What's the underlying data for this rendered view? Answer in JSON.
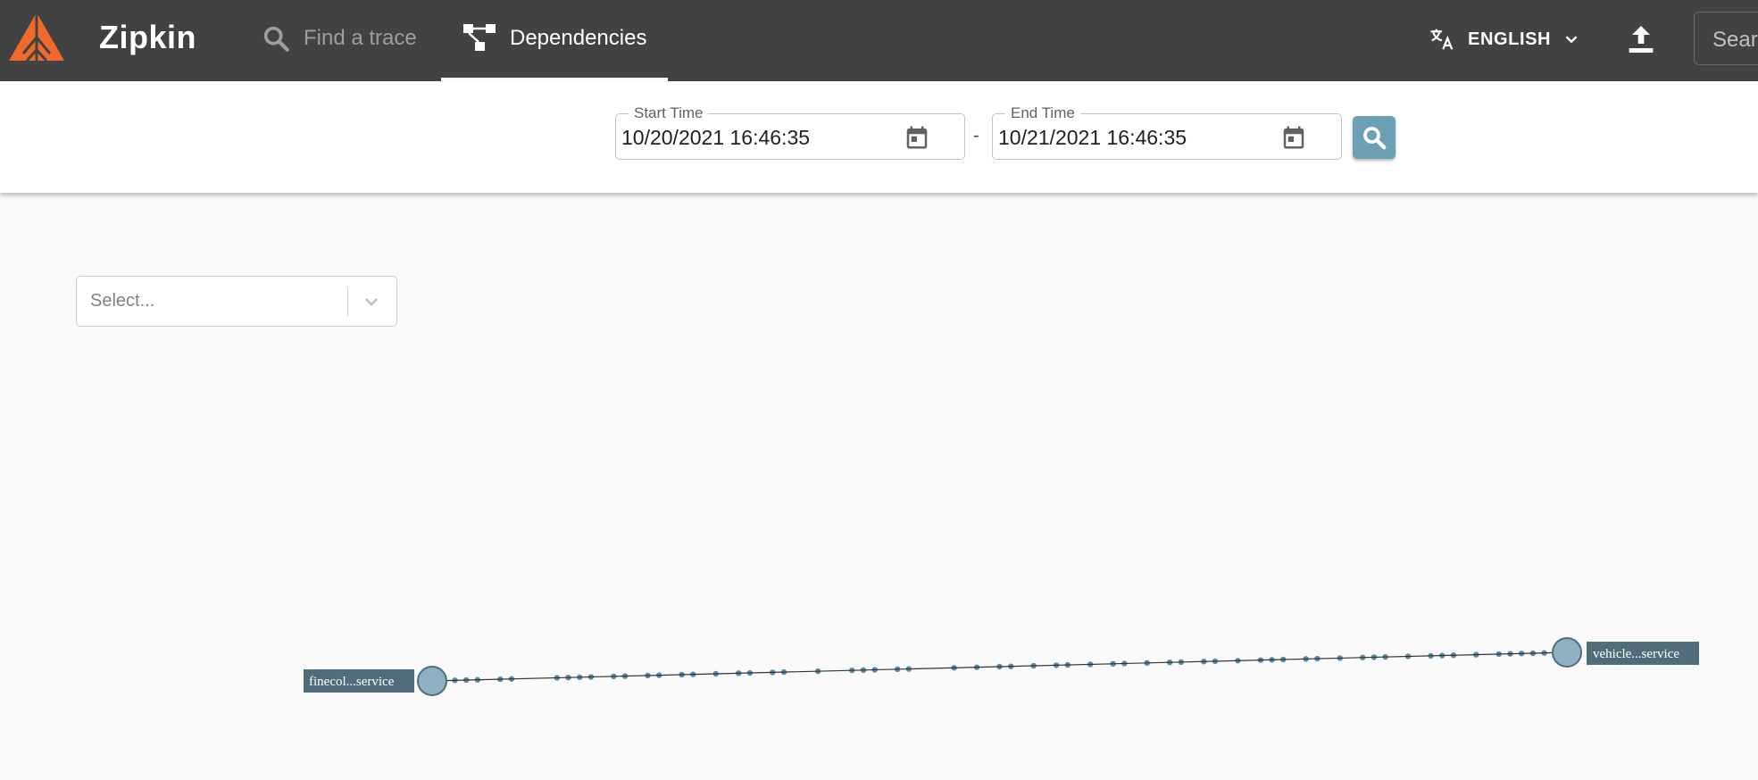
{
  "header": {
    "brand": "Zipkin",
    "nav": {
      "find_trace": "Find a trace",
      "dependencies": "Dependencies"
    },
    "language": "ENGLISH",
    "search_placeholder": "Search"
  },
  "time_range": {
    "start_label": "Start Time",
    "start_value": "10/20/2021 16:46:35",
    "separator": "-",
    "end_label": "End Time",
    "end_value": "10/21/2021 16:46:35"
  },
  "service_select": {
    "placeholder": "Select..."
  },
  "graph": {
    "nodes": [
      {
        "id": "source",
        "label": "finecol...service"
      },
      {
        "id": "target",
        "label": "vehicle...service"
      }
    ],
    "edge": {
      "from": "source",
      "to": "target"
    }
  },
  "colors": {
    "appbar": "#424242",
    "logo": "#f26a2b",
    "accent": "#6d9fb5",
    "node_fill": "#8eb2c4",
    "label_bg": "#4f6d7a",
    "particle": "#5d8aa0"
  },
  "icons": {
    "logo": "zipkin-logo",
    "find": "search-icon",
    "dependencies": "dependencies-icon",
    "language": "translate-icon",
    "upload": "upload-icon",
    "calendar": "calendar-icon"
  }
}
